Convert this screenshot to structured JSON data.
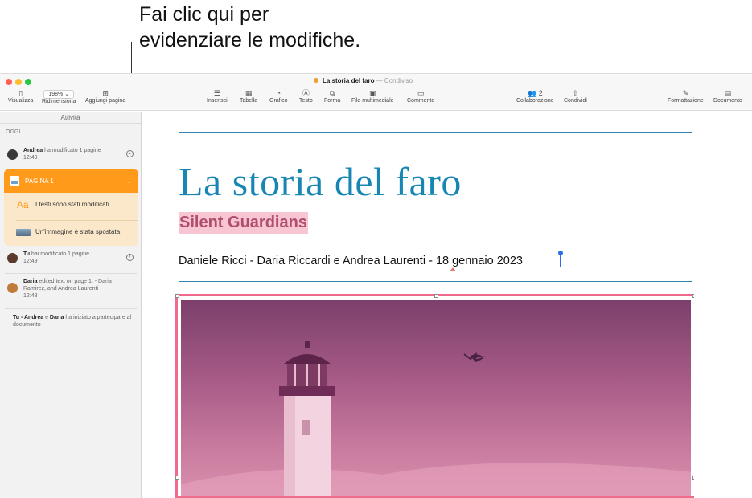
{
  "callout": {
    "line1": "Fai clic qui per",
    "line2": "evidenziare le modifiche."
  },
  "window": {
    "doc_title": "La storia del faro",
    "shared_label": "— Condiviso"
  },
  "toolbar": {
    "view_label": "Visualizza",
    "zoom_value": "198%",
    "zoom_label": "Ridimensiona",
    "add_page_label": "Aggiungi pagina",
    "insert_label": "Inserisci",
    "table_label": "Tabella",
    "chart_label": "Grafico",
    "text_label": "Testo",
    "shape_label": "Forma",
    "media_label": "File multimediale",
    "comment_label": "Commento",
    "collab_count": "2",
    "collab_label": "Collaborazione",
    "share_label": "Condividi",
    "format_label": "Formattazione",
    "document_label": "Documento"
  },
  "sidebar": {
    "header": "Attività",
    "section": "OGGI",
    "activities": [
      {
        "user": "Andrea",
        "action": " ha modificato 1 pagine",
        "time": "12:49",
        "avatar_color": "#3a3a3a"
      },
      {
        "user": "Tu",
        "action": " hai modificato 1 pagine",
        "time": "12:49",
        "avatar_color": "#5a3a2a"
      },
      {
        "user": "Daria",
        "action": " edited text on page 1: - Daria Ramirez, and Andrea Laurenti",
        "time": "12:48",
        "avatar_color": "#c07a3a"
      }
    ],
    "page_block": {
      "title": "PAGINA 1",
      "rows": [
        {
          "icon": "text-change-icon",
          "label": "I testi sono stati modificati..."
        },
        {
          "icon": "image-thumb-icon",
          "label": "Un'immagine è stata spostata"
        }
      ],
      "accent": "#ff9a1a"
    },
    "joined": {
      "users": "Tu - Andrea",
      "and": " e ",
      "user2": "Daria",
      "text": " ha iniziato a partecipare al documento"
    }
  },
  "document": {
    "title": "La storia del faro",
    "subtitle": "Silent Guardians",
    "byline": "Daniele Ricci - Daria Riccardi e Andrea Laurenti - 18 gennaio 2023",
    "title_color": "#1886b3",
    "highlight_color": "#f7c6d2"
  }
}
